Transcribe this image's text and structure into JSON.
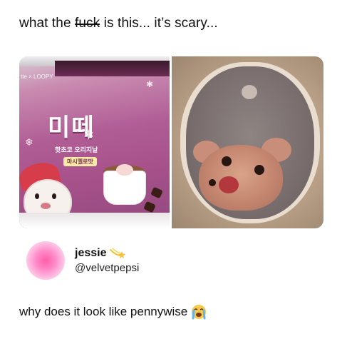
{
  "post": {
    "text_before": "what the ",
    "text_struck": "fuck",
    "text_after": " is this... it’s scary..."
  },
  "photo_left": {
    "brand": "tte × LOOPY",
    "title": "미떼",
    "subtitle": "핫초코 오리지날",
    "variant": "마시멜로맛"
  },
  "reply": {
    "display_name": "jessie",
    "name_badge_icon": "comet-icon",
    "handle": "@velvetpepsi",
    "text": "why does it look like pennywise",
    "emoji_icon": "loudly-crying-face-icon"
  },
  "colors": {
    "avatar_center": "#ff5fa8",
    "text": "#111111"
  }
}
